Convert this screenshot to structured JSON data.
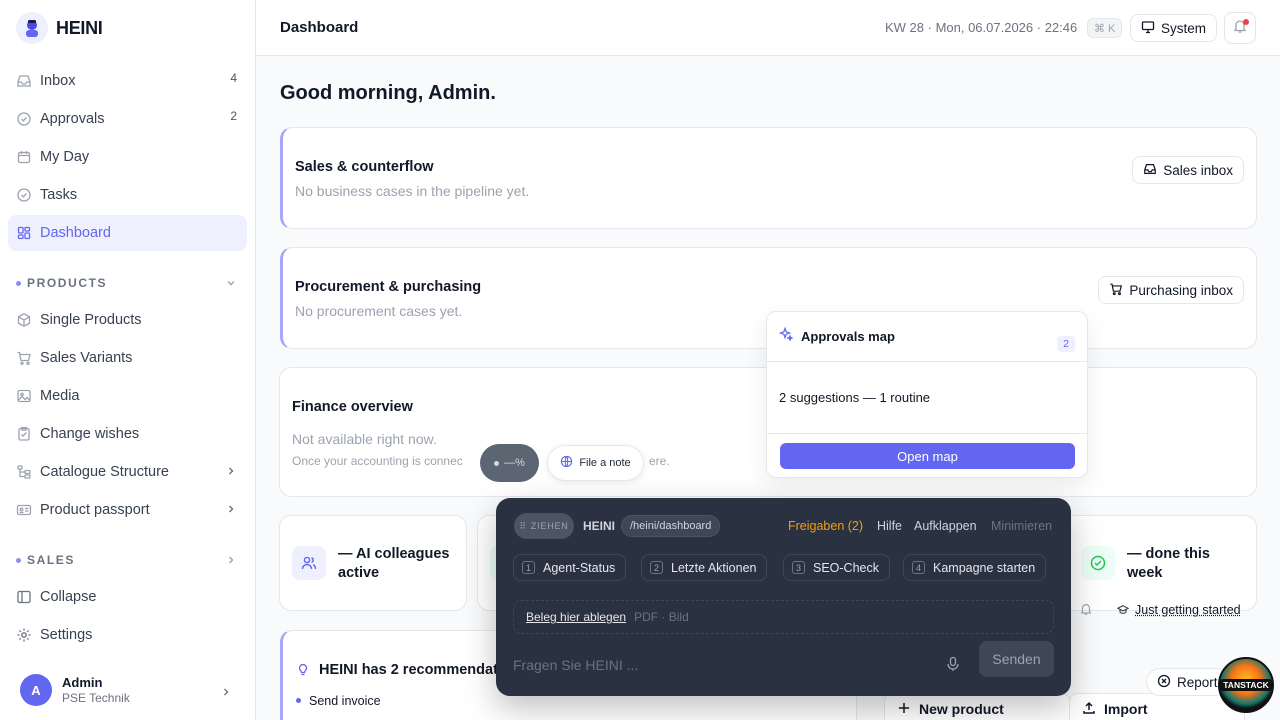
{
  "brand": {
    "name": "HEINI"
  },
  "nav": {
    "items": [
      {
        "label": "Inbox",
        "count": "4"
      },
      {
        "label": "Approvals",
        "count": "2"
      },
      {
        "label": "My Day"
      },
      {
        "label": "Tasks"
      },
      {
        "label": "Dashboard"
      }
    ],
    "products_section": "PRODUCTS",
    "products_items": [
      {
        "label": "Single Products"
      },
      {
        "label": "Sales Variants"
      },
      {
        "label": "Media"
      },
      {
        "label": "Change wishes"
      },
      {
        "label": "Catalogue Structure"
      },
      {
        "label": "Product passport"
      }
    ],
    "sales_section": "SALES",
    "footer_items": [
      {
        "label": "Collapse"
      },
      {
        "label": "Settings"
      }
    ]
  },
  "user": {
    "initial": "A",
    "name": "Admin",
    "org": "PSE Technik"
  },
  "header": {
    "title": "Dashboard",
    "datetime": "KW 28 · Mon, 06.07.2026 · 22:46",
    "shortcut": "⌘ K",
    "theme": "System"
  },
  "main": {
    "greeting": "Good morning, Admin.",
    "sales_card": {
      "title": "Sales & counterflow",
      "sub": "No business cases in the pipeline yet.",
      "button": "Sales inbox"
    },
    "procurement_card": {
      "title": "Procurement & purchasing",
      "sub": "No procurement cases yet.",
      "button": "Purchasing inbox"
    },
    "finance_card": {
      "title": "Finance overview",
      "sub": "Not available right now.",
      "note_start": "Once your accounting is connec",
      "note_end": "ere."
    },
    "stats": [
      {
        "label": "— AI colleagues active"
      },
      {
        "label": "— done this week"
      }
    ],
    "progress_link": "Just getting started",
    "recommendation_title": "HEINI has 2 recommendati",
    "recommendation_item": "Send invoice",
    "report_label": "Report",
    "new_product": "New product",
    "import": "Import"
  },
  "popover": {
    "title": "Approvals map",
    "badge": "2",
    "body": "2 suggestions — 1 routine",
    "button": "Open map"
  },
  "pills": {
    "progress": "—%",
    "note": "File a note"
  },
  "panel": {
    "drag": "ZIEHEN",
    "brand": "HEINI",
    "path": "/heini/dashboard",
    "approvals": "Freigaben (2)",
    "help": "Hilfe",
    "expand": "Aufklappen",
    "minimize": "Minimieren",
    "quick_actions": [
      {
        "num": "1",
        "label": "Agent-Status"
      },
      {
        "num": "2",
        "label": "Letzte Aktionen"
      },
      {
        "num": "3",
        "label": "SEO-Check"
      },
      {
        "num": "4",
        "label": "Kampagne starten"
      }
    ],
    "drop_link": "Beleg hier ablegen",
    "drop_hint": "PDF · Bild",
    "ask_placeholder": "Fragen Sie HEINI ...",
    "send": "Senden"
  },
  "badge": {
    "tanstack": "TANSTACK"
  },
  "colors": {
    "accent": "#6366f1",
    "warning": "#f59e0b",
    "panel_bg": "#2a3140",
    "success": "#22c55e"
  }
}
